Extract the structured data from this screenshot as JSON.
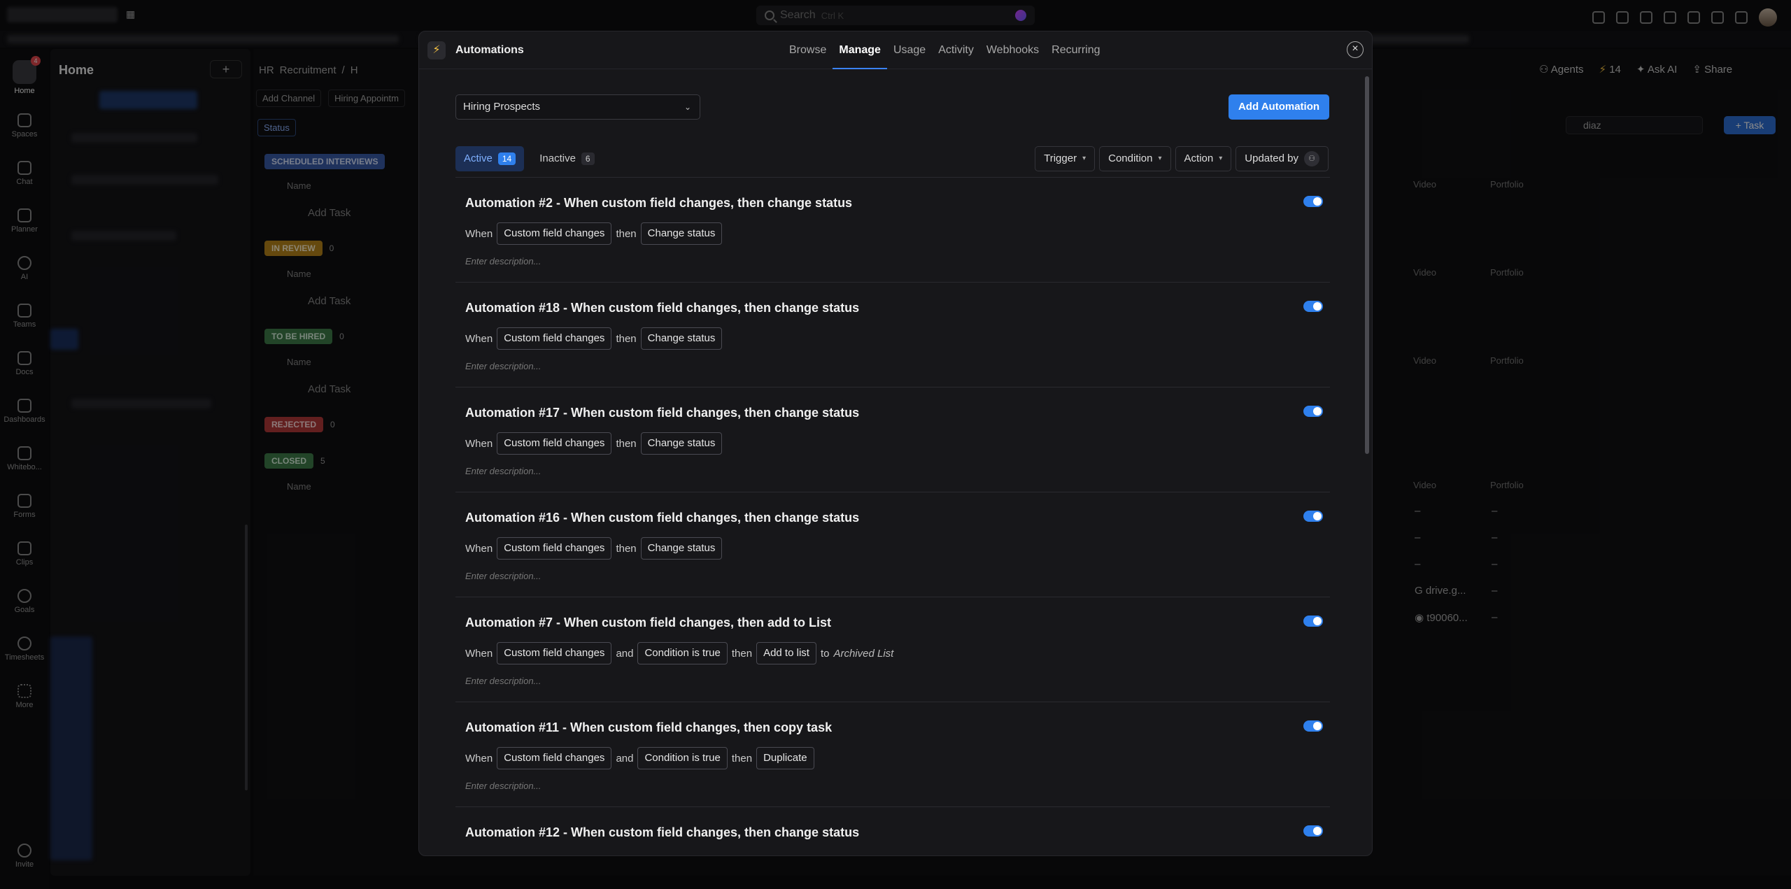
{
  "topbar": {
    "search_placeholder": "Search",
    "search_shortcut": "Ctrl K"
  },
  "rail": {
    "home_badge": "4",
    "items": [
      "Home",
      "Spaces",
      "Chat",
      "Planner",
      "AI",
      "Teams",
      "Docs",
      "Dashboards",
      "Whitebo...",
      "Forms",
      "Clips",
      "Goals",
      "Timesheets",
      "More",
      "Invite"
    ]
  },
  "sidebar": {
    "title": "Home",
    "add": "+"
  },
  "main": {
    "crumbs": [
      "HR",
      "Recruitment",
      "/",
      "H"
    ],
    "chips": [
      "Add Channel",
      "Hiring Appointm"
    ],
    "status_btn": "Status",
    "groups": [
      {
        "label": "SCHEDULED INTERVIEWS",
        "count": "",
        "color": "#3a5ba8"
      },
      {
        "label": "IN REVIEW",
        "count": "0",
        "color": "#b8861b"
      },
      {
        "label": "TO BE HIRED",
        "count": "0",
        "color": "#3f7d4a"
      },
      {
        "label": "REJECTED",
        "count": "0",
        "color": "#b33a3a"
      },
      {
        "label": "CLOSED",
        "count": "5",
        "color": "#3f7d4a"
      }
    ],
    "name_col": "Name",
    "add_task": "Add Task",
    "right_cols": {
      "video": "Video",
      "portfolio": "Portfolio"
    },
    "dash": "–",
    "drive_text": "drive.g...",
    "t_text": "t90060...",
    "right_top": {
      "agents": "Agents",
      "count": "14",
      "ask_ai": "Ask AI",
      "share": "Share"
    },
    "search_value": "diaz",
    "task_btn": "+ Task"
  },
  "modal": {
    "title": "Automations",
    "tabs": [
      "Browse",
      "Manage",
      "Usage",
      "Activity",
      "Webhooks",
      "Recurring"
    ],
    "active_tab": "Manage",
    "list_select": "Hiring Prospects",
    "add_button": "Add Automation",
    "segments": [
      {
        "label": "Active",
        "count": "14"
      },
      {
        "label": "Inactive",
        "count": "6"
      }
    ],
    "filters": [
      "Trigger",
      "Condition",
      "Action",
      "Updated by"
    ],
    "description_placeholder": "Enter description...",
    "automations": [
      {
        "title": "Automation #2 - When custom field changes, then change status",
        "rule": [
          "When",
          "[Custom field changes]",
          "then",
          "[Change status]"
        ]
      },
      {
        "title": "Automation #18 - When custom field changes, then change status",
        "rule": [
          "When",
          "[Custom field changes]",
          "then",
          "[Change status]"
        ]
      },
      {
        "title": "Automation #17 - When custom field changes, then change status",
        "rule": [
          "When",
          "[Custom field changes]",
          "then",
          "[Change status]"
        ]
      },
      {
        "title": "Automation #16 - When custom field changes, then change status",
        "rule": [
          "When",
          "[Custom field changes]",
          "then",
          "[Change status]"
        ]
      },
      {
        "title": "Automation #7 - When custom field changes, then add to List",
        "rule": [
          "When",
          "[Custom field changes]",
          "and",
          "[Condition is true]",
          "then",
          "[Add to list]",
          "to",
          "*Archived List"
        ]
      },
      {
        "title": "Automation #11 - When custom field changes, then copy task",
        "rule": [
          "When",
          "[Custom field changes]",
          "and",
          "[Condition is true]",
          "then",
          "[Duplicate]"
        ]
      },
      {
        "title": "Automation #12 - When custom field changes, then change status",
        "rule": []
      }
    ]
  }
}
